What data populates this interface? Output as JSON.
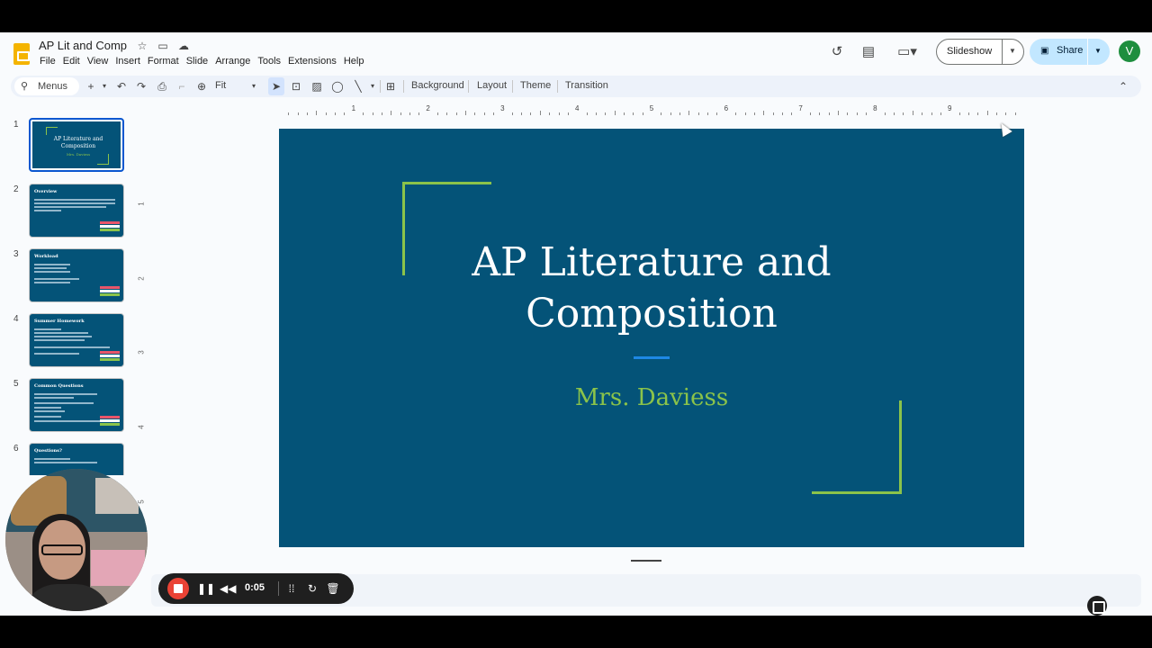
{
  "window": {
    "doc_title": "AP Lit and Comp"
  },
  "menubar": [
    "File",
    "Edit",
    "View",
    "Insert",
    "Format",
    "Slide",
    "Arrange",
    "Tools",
    "Extensions",
    "Help"
  ],
  "header": {
    "slideshow_label": "Slideshow",
    "share_label": "Share",
    "avatar_initial": "V"
  },
  "toolbar": {
    "menus_label": "Menus",
    "zoom_label": "Fit",
    "background_label": "Background",
    "layout_label": "Layout",
    "theme_label": "Theme",
    "transition_label": "Transition"
  },
  "ruler": {
    "numbers": [
      "1",
      "2",
      "3",
      "4",
      "5",
      "6",
      "7",
      "8",
      "9"
    ]
  },
  "vruler": {
    "numbers": [
      "1",
      "2",
      "3",
      "4",
      "5"
    ]
  },
  "filmstrip": {
    "slides": [
      {
        "num": "1",
        "title": "AP Literature and Composition",
        "subtitle": "Mrs. Daviess"
      },
      {
        "num": "2",
        "title": "Overview"
      },
      {
        "num": "3",
        "title": "Workload"
      },
      {
        "num": "4",
        "title": "Summer Homework"
      },
      {
        "num": "5",
        "title": "Common Questions"
      },
      {
        "num": "6",
        "title": "Questions?"
      }
    ]
  },
  "slide": {
    "title": "AP Literature and Composition",
    "subtitle": "Mrs. Daviess"
  },
  "recorder": {
    "time": "0:05"
  },
  "colors": {
    "slide_bg": "#045378",
    "accent_green": "#8bc34a",
    "accent_blue": "#1e88e5",
    "share_bg": "#c2e7ff",
    "record_red": "#ea4335"
  }
}
